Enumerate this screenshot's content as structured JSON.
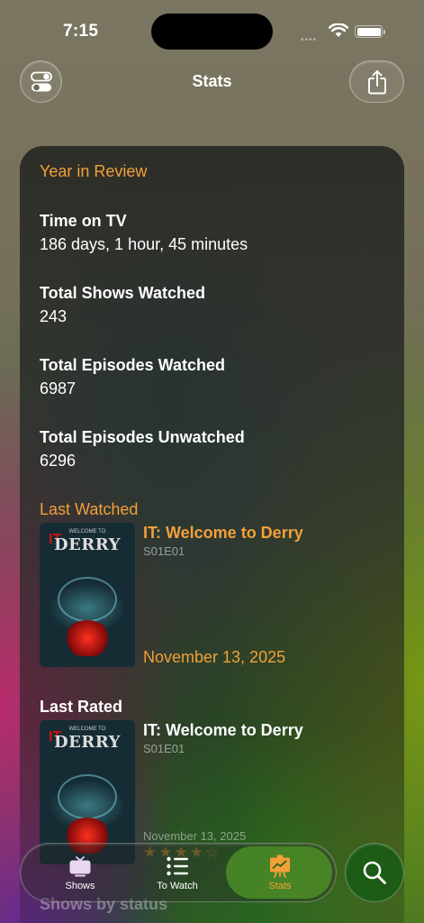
{
  "status_bar": {
    "time": "7:15",
    "signal": "••••"
  },
  "nav": {
    "title": "Stats",
    "left_icon": "toggles-icon",
    "right_icon": "share-icon"
  },
  "year_in_review": {
    "header": "Year in Review",
    "stats": [
      {
        "label": "Time on TV",
        "value": "186 days, 1 hour, 45 minutes"
      },
      {
        "label": "Total Shows Watched",
        "value": "243"
      },
      {
        "label": "Total Episodes Watched",
        "value": "6987"
      },
      {
        "label": "Total Episodes Unwatched",
        "value": "6296"
      }
    ]
  },
  "last_watched": {
    "header": "Last Watched",
    "title": "IT: Welcome to Derry",
    "episode": "S01E01",
    "date": "November 13, 2025",
    "poster": {
      "brand": "IT",
      "small": "WELCOME TO",
      "big": "DERRY"
    }
  },
  "last_rated": {
    "header": "Last Rated",
    "title": "IT: Welcome to Derry",
    "episode": "S01E01",
    "date": "November 13, 2025",
    "rating": 4,
    "rating_max": 5,
    "poster": {
      "brand": "IT",
      "small": "WELCOME TO",
      "big": "DERRY"
    }
  },
  "next_section": {
    "header": "Shows by status"
  },
  "tabs": [
    {
      "label": "Shows",
      "icon": "tv-icon",
      "active": false
    },
    {
      "label": "To Watch",
      "icon": "list-icon",
      "active": false
    },
    {
      "label": "Stats",
      "icon": "chart-icon",
      "active": true
    }
  ],
  "search": {
    "icon": "search-icon"
  },
  "colors": {
    "accent": "#f3a038",
    "active_tab": "#4f9628",
    "search_bg": "#145a14"
  }
}
